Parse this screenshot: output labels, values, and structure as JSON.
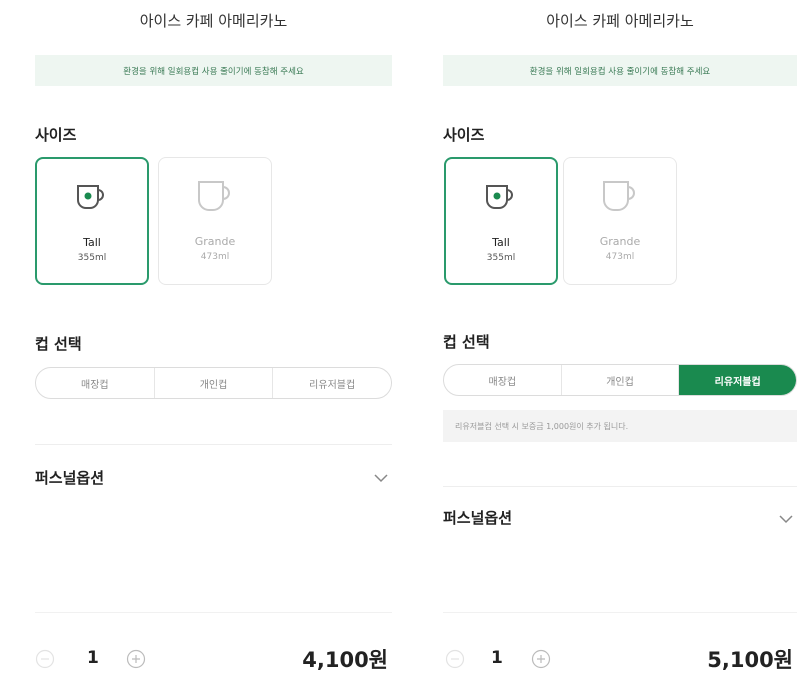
{
  "screens": [
    {
      "title": "아이스 카페 아메리카노",
      "notice": "환경을 위해 일회용컵 사용 줄이기에 동참해 주세요",
      "size_section": "사이즈",
      "sizes": [
        {
          "name": "Tall",
          "volume": "355ml",
          "selected": true
        },
        {
          "name": "Grande",
          "volume": "473ml",
          "selected": false
        }
      ],
      "cup_section": "컵 선택",
      "cup_options": [
        "매장컵",
        "개인컵",
        "리유저블컵"
      ],
      "selected_cup": null,
      "personal_option": "퍼스널옵션",
      "quantity": "1",
      "price": "4,100원"
    },
    {
      "title": "아이스 카페 아메리카노",
      "notice": "환경을 위해 일회용컵 사용 줄이기에 동참해 주세요",
      "size_section": "사이즈",
      "sizes": [
        {
          "name": "Tall",
          "volume": "355ml",
          "selected": true
        },
        {
          "name": "Grande",
          "volume": "473ml",
          "selected": false
        }
      ],
      "cup_section": "컵 선택",
      "cup_options": [
        "매장컵",
        "개인컵",
        "리유저블컵"
      ],
      "selected_cup": "리유저블컵",
      "cup_note": "리유저블컵 선택 시 보증금 1,000원이 추가 됩니다.",
      "personal_option": "퍼스널옵션",
      "quantity": "1",
      "price": "5,100원"
    }
  ],
  "colors": {
    "accent": "#1a8a4f",
    "selected_border": "#2a9a6c",
    "notice_bg": "#eef6f1"
  },
  "icons": {
    "cup": "mug-icon",
    "expand": "chevron-down-icon",
    "minus": "minus-circle-icon",
    "plus": "plus-circle-icon"
  }
}
